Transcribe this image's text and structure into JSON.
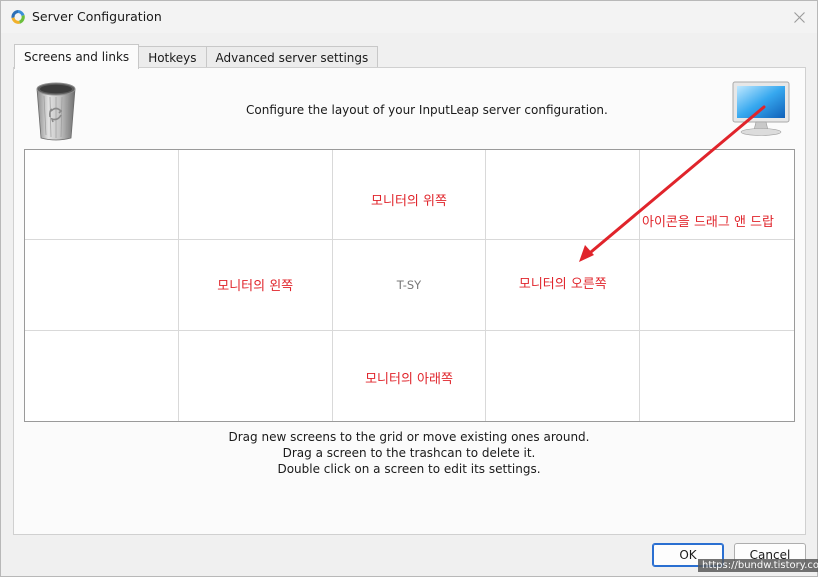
{
  "window": {
    "title": "Server Configuration"
  },
  "tabs": [
    {
      "label": "Screens and links",
      "active": true
    },
    {
      "label": "Hotkeys",
      "active": false
    },
    {
      "label": "Advanced server settings",
      "active": false
    }
  ],
  "main": {
    "headline": "Configure the layout of your InputLeap server configuration.",
    "grid": {
      "top_label": "모니터의 위쪽",
      "left_label": "모니터의 왼쪽",
      "center_screen": "T-SY",
      "right_label": "모니터의 오른쪽",
      "bottom_label": "모니터의 아래쪽"
    },
    "drag_annotation": "아이콘을 드래그 앤 드랍",
    "instructions": [
      "Drag new screens to the grid or move existing ones around.",
      "Drag a screen to the trashcan to delete it.",
      "Double click on a screen to edit its settings."
    ]
  },
  "footer": {
    "ok_label": "OK",
    "cancel_label": "Cancel"
  },
  "watermark": "https://bundw.tistory.com",
  "colors": {
    "annotation": "#e0242b",
    "ok_border": "#2a6fd1"
  },
  "icons": [
    "app-icon",
    "close-icon",
    "trashcan-icon",
    "monitor-icon"
  ]
}
